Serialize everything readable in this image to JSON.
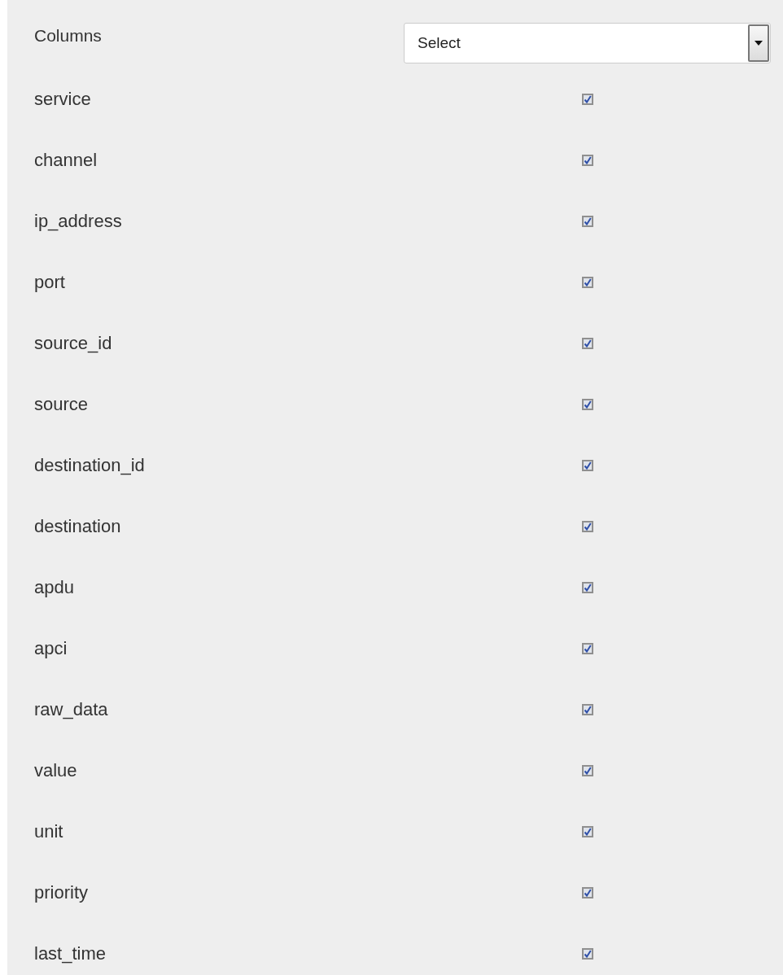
{
  "header": {
    "label": "Columns",
    "select": {
      "value": "Select"
    }
  },
  "columns": [
    {
      "name": "service",
      "checked": true
    },
    {
      "name": "channel",
      "checked": true
    },
    {
      "name": "ip_address",
      "checked": true
    },
    {
      "name": "port",
      "checked": true
    },
    {
      "name": "source_id",
      "checked": true
    },
    {
      "name": "source",
      "checked": true
    },
    {
      "name": "destination_id",
      "checked": true
    },
    {
      "name": "destination",
      "checked": true
    },
    {
      "name": "apdu",
      "checked": true
    },
    {
      "name": "apci",
      "checked": true
    },
    {
      "name": "raw_data",
      "checked": true
    },
    {
      "name": "value",
      "checked": true
    },
    {
      "name": "unit",
      "checked": true
    },
    {
      "name": "priority",
      "checked": true
    },
    {
      "name": "last_time",
      "checked": true
    }
  ]
}
